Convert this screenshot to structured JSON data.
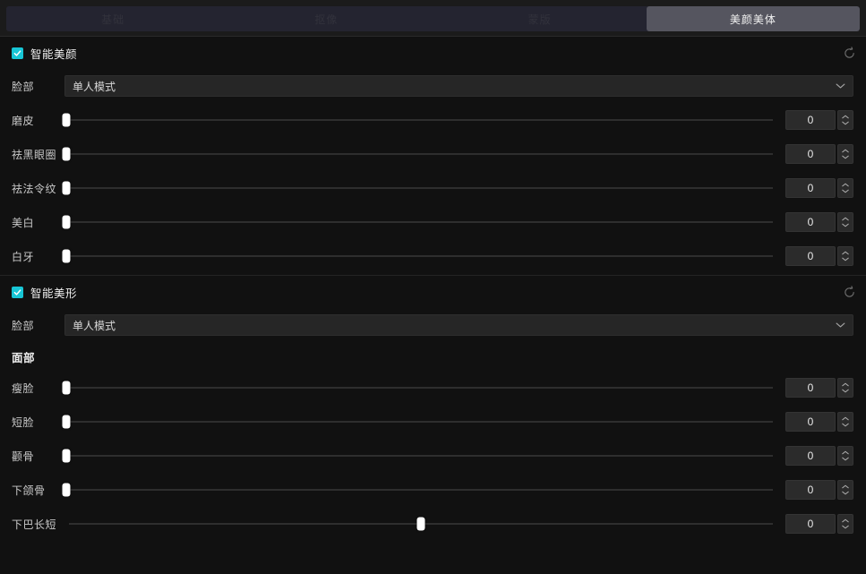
{
  "tabs": [
    {
      "label": "基础",
      "active": false
    },
    {
      "label": "抠像",
      "active": false
    },
    {
      "label": "蒙版",
      "active": false
    },
    {
      "label": "美颜美体",
      "active": true
    }
  ],
  "sections": [
    {
      "title": "智能美颜",
      "enabled": true,
      "reset_icon": "reset-icon",
      "select": {
        "label": "脸部",
        "value": "单人模式"
      },
      "sliders": [
        {
          "label": "磨皮",
          "value": "0",
          "percent": 0
        },
        {
          "label": "祛黑眼圈",
          "value": "0",
          "percent": 0
        },
        {
          "label": "祛法令纹",
          "value": "0",
          "percent": 0
        },
        {
          "label": "美白",
          "value": "0",
          "percent": 0
        },
        {
          "label": "白牙",
          "value": "0",
          "percent": 0
        }
      ]
    },
    {
      "title": "智能美形",
      "enabled": true,
      "reset_icon": "reset-icon",
      "select": {
        "label": "脸部",
        "value": "单人模式"
      },
      "subhead": "面部",
      "sliders": [
        {
          "label": "瘦脸",
          "value": "0",
          "percent": 0
        },
        {
          "label": "短脸",
          "value": "0",
          "percent": 0
        },
        {
          "label": "颧骨",
          "value": "0",
          "percent": 0
        },
        {
          "label": "下颌骨",
          "value": "0",
          "percent": 0
        },
        {
          "label": "下巴长短",
          "value": "0",
          "percent": 50
        }
      ]
    }
  ],
  "colors": {
    "accent": "#18c6d6",
    "tab_active_bg": "#55555f",
    "panel_bg": "#111111",
    "thumb": "#ffffff"
  }
}
